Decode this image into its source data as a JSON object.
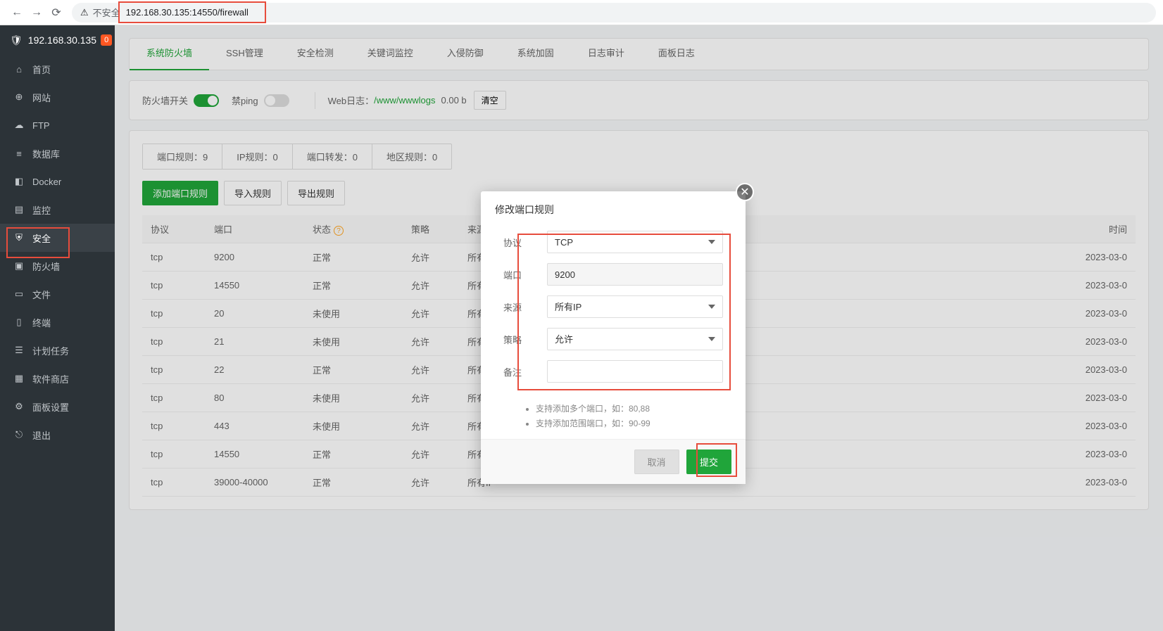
{
  "browser": {
    "insecure_label": "不安全",
    "url": "192.168.30.135:14550/firewall"
  },
  "sidebar": {
    "host": "192.168.30.135",
    "badge": "0",
    "items": [
      {
        "label": "首页"
      },
      {
        "label": "网站"
      },
      {
        "label": "FTP"
      },
      {
        "label": "数据库"
      },
      {
        "label": "Docker"
      },
      {
        "label": "监控"
      },
      {
        "label": "安全"
      },
      {
        "label": "防火墙"
      },
      {
        "label": "文件"
      },
      {
        "label": "终端"
      },
      {
        "label": "计划任务"
      },
      {
        "label": "软件商店"
      },
      {
        "label": "面板设置"
      },
      {
        "label": "退出"
      }
    ]
  },
  "tabs": [
    "系统防火墙",
    "SSH管理",
    "安全检测",
    "关键词监控",
    "入侵防御",
    "系统加固",
    "日志审计",
    "面板日志"
  ],
  "toolbar": {
    "fw_label": "防火墙开关",
    "ping_label": "禁ping",
    "weblog_label": "Web日志：",
    "weblog_path": "/www/wwwlogs",
    "weblog_size": "0.00 b",
    "clear": "清空"
  },
  "subtabs": [
    "端口规则：9",
    "IP规则：0",
    "端口转发：0",
    "地区规则：0"
  ],
  "actions": {
    "add": "添加端口规则",
    "import": "导入规则",
    "export": "导出规则"
  },
  "table": {
    "headers": {
      "proto": "协议",
      "port": "端口",
      "status": "状态",
      "policy": "策略",
      "source": "来源",
      "time": "时间"
    },
    "rows": [
      {
        "proto": "tcp",
        "port": "9200",
        "status": "正常",
        "policy": "允许",
        "source": "所有IP",
        "time": "2023-03-0"
      },
      {
        "proto": "tcp",
        "port": "14550",
        "status": "正常",
        "policy": "允许",
        "source": "所有IP",
        "time": "2023-03-0"
      },
      {
        "proto": "tcp",
        "port": "20",
        "status": "未使用",
        "policy": "允许",
        "source": "所有IP",
        "time": "2023-03-0"
      },
      {
        "proto": "tcp",
        "port": "21",
        "status": "未使用",
        "policy": "允许",
        "source": "所有IP",
        "time": "2023-03-0"
      },
      {
        "proto": "tcp",
        "port": "22",
        "status": "正常",
        "policy": "允许",
        "source": "所有IP",
        "time": "2023-03-0"
      },
      {
        "proto": "tcp",
        "port": "80",
        "status": "未使用",
        "policy": "允许",
        "source": "所有IP",
        "time": "2023-03-0"
      },
      {
        "proto": "tcp",
        "port": "443",
        "status": "未使用",
        "policy": "允许",
        "source": "所有IP",
        "time": "2023-03-0"
      },
      {
        "proto": "tcp",
        "port": "14550",
        "status": "正常",
        "policy": "允许",
        "source": "所有IP",
        "time": "2023-03-0"
      },
      {
        "proto": "tcp",
        "port": "39000-40000",
        "status": "正常",
        "policy": "允许",
        "source": "所有IP",
        "time": "2023-03-0"
      }
    ]
  },
  "modal": {
    "title": "修改端口规则",
    "labels": {
      "proto": "协议",
      "port": "端口",
      "source": "来源",
      "policy": "策略",
      "remark": "备注"
    },
    "values": {
      "proto": "TCP",
      "port": "9200",
      "source": "所有IP",
      "policy": "允许",
      "remark": ""
    },
    "hints": [
      "支持添加多个端口，如：80,88",
      "支持添加范围端口，如：90-99"
    ],
    "cancel": "取消",
    "submit": "提交"
  }
}
